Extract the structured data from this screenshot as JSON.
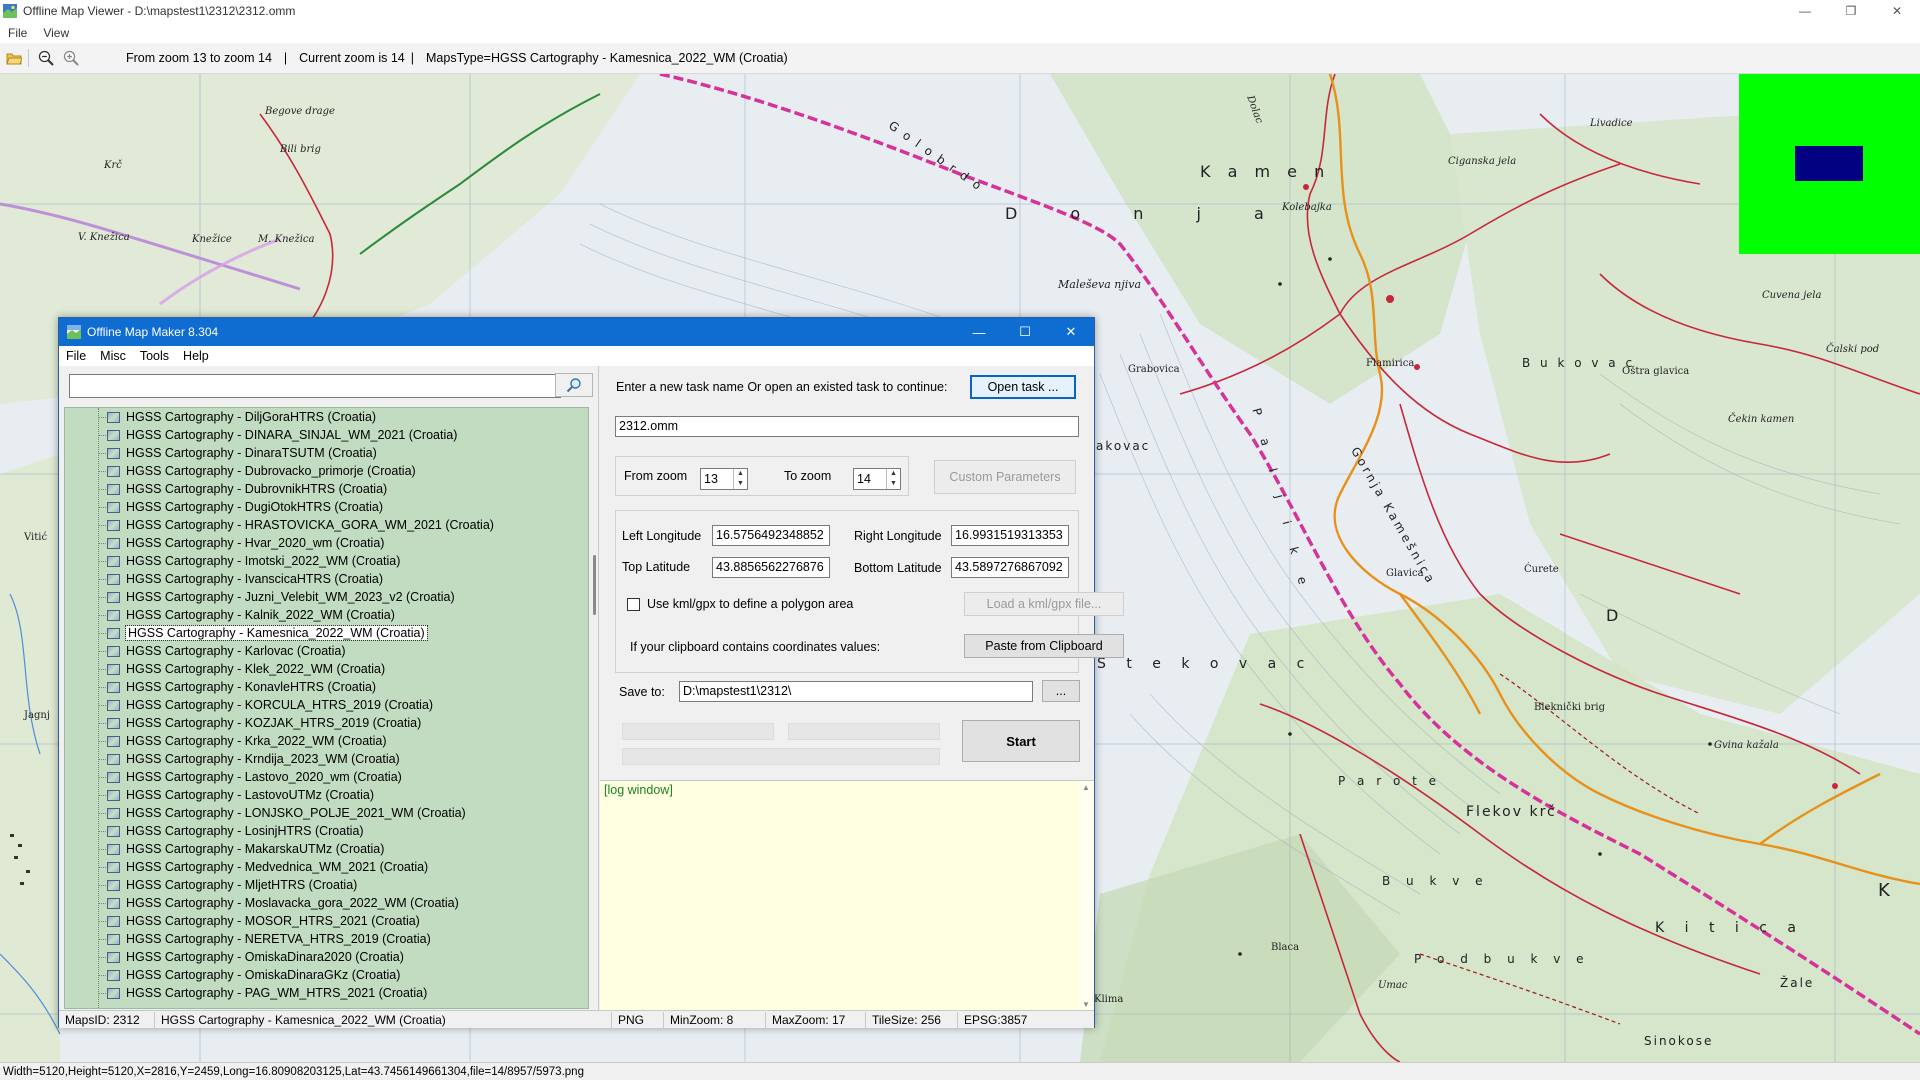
{
  "viewer": {
    "title": "Offline Map Viewer - D:\\mapstest1\\2312\\2312.omm",
    "menu": [
      "File",
      "View"
    ],
    "toolbar_info": {
      "zoom_range": "From zoom 13 to zoom 14",
      "current_zoom": "Current zoom is 14",
      "maps_type": "MapsType=HGSS Cartography - Kamesnica_2022_WM (Croatia)"
    },
    "status": "Width=5120,Height=5120,X=2816,Y=2459,Long=16.80908203125,Lat=43.7456149661304,file=14/8957/5973.png",
    "icons": [
      "open-folder-icon",
      "zoom-out-icon",
      "zoom-in-icon"
    ]
  },
  "map": {
    "labels": {
      "kamen": "K a m e n",
      "donja": "D o n j a",
      "golo_brdo": "G o l o   b r d o",
      "paljike": "P a l j i k e",
      "stekovac": "Š t e k o v a c",
      "parote": "P a r o t e",
      "flekov_krc": "Flekov krč",
      "bukve": "B u k v e",
      "podbukve": "P o d b u k v e",
      "kitica": "K i t i c a",
      "bukovac": "B u k o v a c",
      "gornja_kamesnica": "Gornja Kamešnica",
      "sinokose": "Sinokose",
      "zale": "Žale",
      "cigansko_jela": "Ciganska jela",
      "livadice": "Livadice",
      "kolebajka": "Kolebajka",
      "maleseva_njiva": "Maleševa njiva",
      "begove_drage": "Begove drage",
      "bili_brig": "Bili brig",
      "krc": "Krč",
      "knezice": "Knežice",
      "m_knezica": "M. Knežica",
      "v_knezica": "V. Knežica",
      "vitic": "Vitić",
      "jagnj": "Jagnj",
      "blaca": "Blaca",
      "grabovica": "Grabovica",
      "akovac": "akovac",
      "flamirica": "Flamirica",
      "cuvena_jela": "Cuvena jela",
      "oštra_glavica": "Oštra glavica",
      "cekin_kamen": "Čekin kamen",
      "calski_pod": "Čalski pod",
      "curete": "Ćurete",
      "glavica": "Glavica",
      "bleknicki": "Bleknički brig",
      "gvina_kazala": "Gvina kažala",
      "k": "K",
      "d": "D",
      "klima": "Klima",
      "umac": "Umac",
      "dolac": "Dolac"
    }
  },
  "dialog": {
    "title": "Offline Map Maker 8.304",
    "menu": [
      "File",
      "Misc",
      "Tools",
      "Help"
    ],
    "search": {
      "value": "",
      "placeholder": ""
    },
    "map_list": [
      "HGSS Cartography - DiljGoraHTRS (Croatia)",
      "HGSS Cartography - DINARA_SINJAL_WM_2021 (Croatia)",
      "HGSS Cartography - DinaraTSUTM (Croatia)",
      "HGSS Cartography - Dubrovacko_primorje (Croatia)",
      "HGSS Cartography - DubrovnikHTRS (Croatia)",
      "HGSS Cartography - DugiOtokHTRS (Croatia)",
      "HGSS Cartography - HRASTOVICKA_GORA_WM_2021 (Croatia)",
      "HGSS Cartography - Hvar_2020_wm (Croatia)",
      "HGSS Cartography - Imotski_2022_WM (Croatia)",
      "HGSS Cartography - IvanscicaHTRS (Croatia)",
      "HGSS Cartography - Juzni_Velebit_WM_2023_v2 (Croatia)",
      "HGSS Cartography - Kalnik_2022_WM (Croatia)",
      "HGSS Cartography - Kamesnica_2022_WM (Croatia)",
      "HGSS Cartography - Karlovac (Croatia)",
      "HGSS Cartography - Klek_2022_WM (Croatia)",
      "HGSS Cartography - KonavleHTRS (Croatia)",
      "HGSS Cartography - KORCULA_HTRS_2019 (Croatia)",
      "HGSS Cartography - KOZJAK_HTRS_2019 (Croatia)",
      "HGSS Cartography - Krka_2022_WM (Croatia)",
      "HGSS Cartography - Krndija_2023_WM (Croatia)",
      "HGSS Cartography - Lastovo_2020_wm (Croatia)",
      "HGSS Cartography - LastovoUTMz (Croatia)",
      "HGSS Cartography - LONJSKO_POLJE_2021_WM (Croatia)",
      "HGSS Cartography - LosinjHTRS (Croatia)",
      "HGSS Cartography - MakarskaUTMz (Croatia)",
      "HGSS Cartography - Medvednica_WM_2021 (Croatia)",
      "HGSS Cartography - MljetHTRS (Croatia)",
      "HGSS Cartography - Moslavacka_gora_2022_WM (Croatia)",
      "HGSS Cartography - MOSOR_HTRS_2021 (Croatia)",
      "HGSS Cartography - NERETVA_HTRS_2019 (Croatia)",
      "HGSS Cartography - OmiskaDinara2020 (Croatia)",
      "HGSS Cartography - OmiskaDinaraGKz (Croatia)",
      "HGSS Cartography - PAG_WM_HTRS_2021 (Croatia)"
    ],
    "selected_index": 12,
    "task_prompt": "Enter a new task name Or open an existed task to continue:",
    "open_task_label": "Open task ...",
    "task_name": "2312.omm",
    "from_zoom_label": "From zoom",
    "from_zoom": "13",
    "to_zoom_label": "To zoom",
    "to_zoom": "14",
    "custom_params_label": "Custom Parameters",
    "left_lon_label": "Left Longitude",
    "left_lon": "16.5756492348852",
    "right_lon_label": "Right Longitude",
    "right_lon": "16.9931519313353",
    "top_lat_label": "Top Latitude",
    "top_lat": "43.8856562276876",
    "bottom_lat_label": "Bottom Latitude",
    "bottom_lat": "43.5897276867092",
    "kml_label": "Use kml/gpx to define a polygon area",
    "kml_button": "Load a kml/gpx file...",
    "clipboard_label": "If your clipboard contains coordinates values:",
    "clipboard_button": "Paste from Clipboard",
    "save_to_label": "Save to:",
    "save_to": "D:\\mapstest1\\2312\\",
    "browse_label": "...",
    "start_label": "Start",
    "log_text": "[log window]",
    "status": {
      "maps_id": "MapsID: 2312",
      "maps_name": "HGSS Cartography - Kamesnica_2022_WM (Croatia)",
      "format": "PNG",
      "min_zoom": "MinZoom: 8",
      "max_zoom": "MaxZoom: 17",
      "tile_size": "TileSize: 256",
      "epsg": "EPSG:3857"
    }
  },
  "colors": {
    "dialog_titlebar": "#0f6cd0",
    "tree_bg": "#c1dcc1",
    "log_bg": "#ffffe1",
    "overview_green": "#00ff00",
    "overview_view": "#000080",
    "border_line": "#d6339a"
  }
}
